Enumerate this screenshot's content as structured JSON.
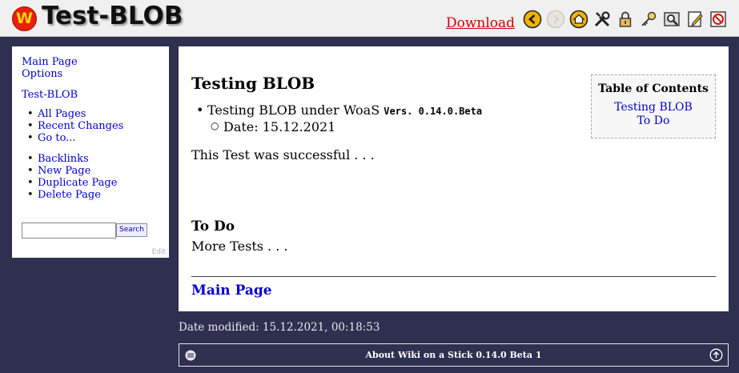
{
  "header": {
    "title": "Test-BLOB",
    "logo_letter": "W",
    "download_label": "Download",
    "toolbar_icons": [
      "back-icon",
      "forward-icon",
      "home-icon",
      "tools-icon",
      "lock-icon",
      "key-icon",
      "search-page-icon",
      "edit-icon",
      "no-icon"
    ]
  },
  "sidebar": {
    "main_page": "Main Page",
    "options": "Options",
    "wiki_title": "Test-BLOB",
    "list1": [
      "All Pages",
      "Recent Changes",
      "Go to..."
    ],
    "list2": [
      "Backlinks",
      "New Page",
      "Duplicate Page",
      "Delete Page"
    ],
    "search_value": "",
    "search_button": "Search",
    "edit_label": "Edit"
  },
  "content": {
    "heading": "Testing BLOB",
    "bullet_text": "Testing BLOB under WoaS",
    "bullet_code": "Vers. 0.14.0.Beta",
    "sub_bullet": "Date: 15.12.2021",
    "paragraph": "This Test was successful . . .",
    "todo_heading": "To Do",
    "todo_text": "More Tests . . .",
    "footer_link": "Main Page"
  },
  "toc": {
    "title": "Table of Contents",
    "items": [
      "Testing BLOB",
      "To Do"
    ]
  },
  "footer": {
    "date_modified": "Date modified: 15.12.2021, 00:18:53",
    "about": "About Wiki on a Stick 0.14.0 Beta 1"
  },
  "colors": {
    "background": "#2f2f4f",
    "link": "#0000cc",
    "download": "#cc0000",
    "logo": "#e8200c"
  }
}
